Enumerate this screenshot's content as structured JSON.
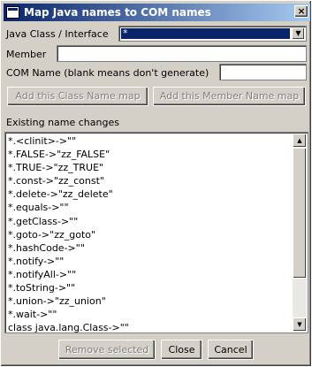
{
  "window": {
    "title": "Map Java names to COM names",
    "close_glyph": "×"
  },
  "form": {
    "class_label": "Java Class / Interface",
    "class_value": "*",
    "member_label": "Member",
    "member_value": "",
    "com_label": "COM Name (blank means don't generate)",
    "com_value": ""
  },
  "buttons": {
    "add_class": "Add this Class Name map",
    "add_member": "Add this Member Name map",
    "remove_selected": "Remove selected",
    "close": "Close",
    "cancel": "Cancel"
  },
  "list": {
    "heading": "Existing name changes",
    "items": [
      "*.<clinit>->\"\"",
      "*.FALSE->\"zz_FALSE\"",
      "*.TRUE->\"zz_TRUE\"",
      "*.const->\"zz_const\"",
      "*.delete->\"zz_delete\"",
      "*.equals->\"\"",
      "*.getClass->\"\"",
      "*.goto->\"zz_goto\"",
      "*.hashCode->\"\"",
      "*.notify->\"\"",
      "*.notifyAll->\"\"",
      "*.toString->\"\"",
      "*.union->\"zz_union\"",
      "*.wait->\"\"",
      "class java.lang.Class->\"\""
    ]
  },
  "colors": {
    "title_active": "#0a246a",
    "face": "#d4d0c8",
    "selection": "#0a246a"
  },
  "icons": {
    "combo_arrow": "▼",
    "scroll_up": "▲",
    "scroll_down": "▼"
  }
}
